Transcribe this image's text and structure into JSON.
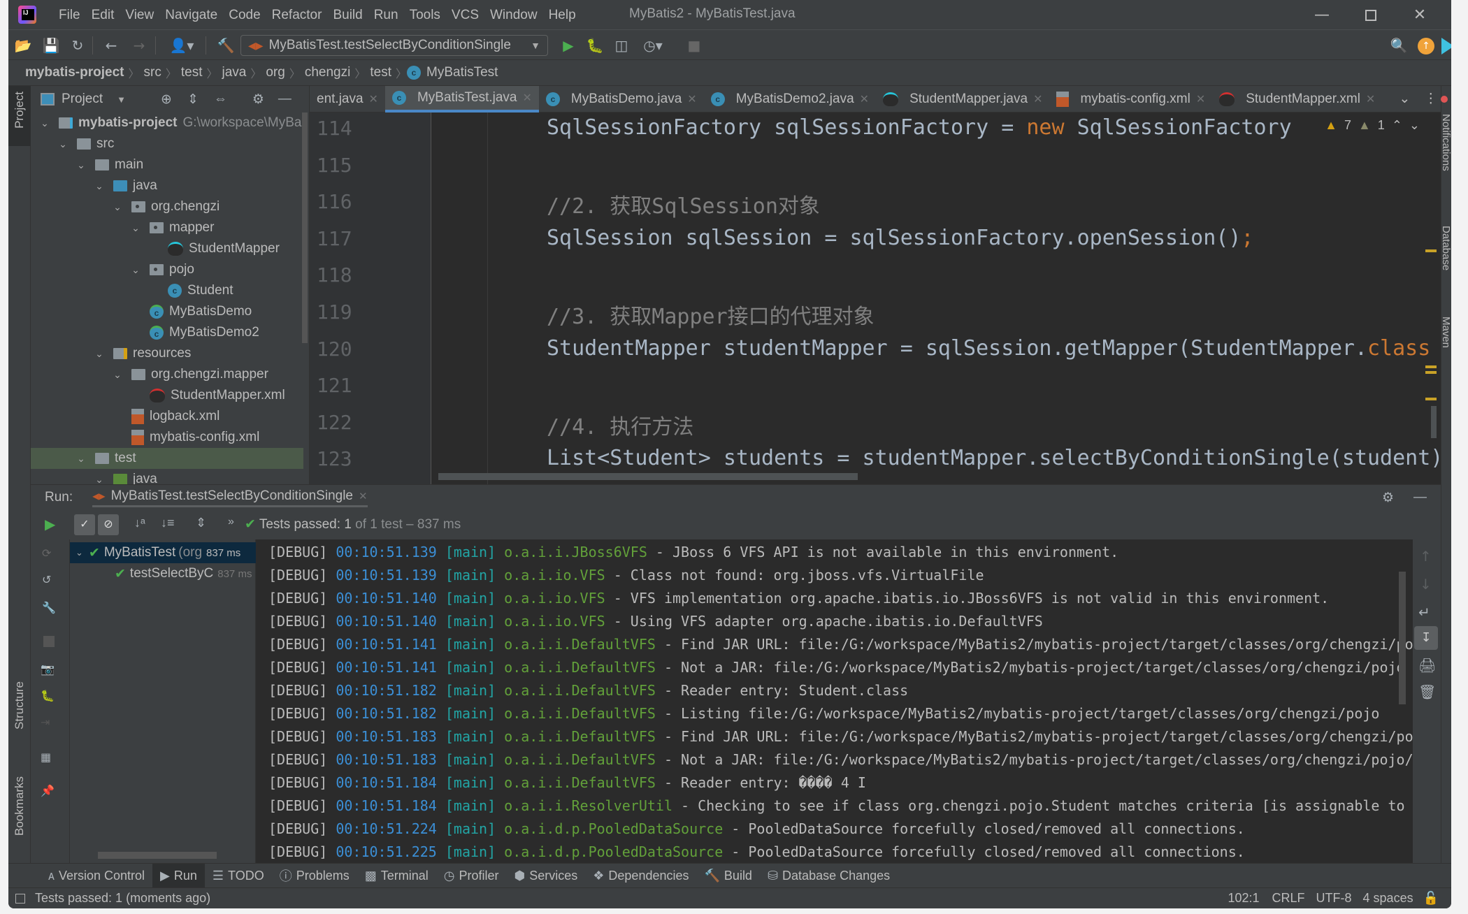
{
  "window": {
    "title": "MyBatis2 - MyBatisTest.java",
    "menu": [
      "File",
      "Edit",
      "View",
      "Navigate",
      "Code",
      "Refactor",
      "Build",
      "Run",
      "Tools",
      "VCS",
      "Window",
      "Help"
    ]
  },
  "toolbar": {
    "run_config": "MyBatisTest.testSelectByConditionSingle"
  },
  "breadcrumb": [
    "mybatis-project",
    "src",
    "test",
    "java",
    "org",
    "chengzi",
    "test",
    "MyBatisTest"
  ],
  "left_stripe": {
    "project": "Project",
    "structure": "Structure",
    "bookmarks": "Bookmarks"
  },
  "project_panel": {
    "title": "Project",
    "tree": [
      {
        "label": "mybatis-project",
        "extra": "G:\\workspace\\MyBa",
        "depth": 0,
        "icon": "module",
        "expanded": true
      },
      {
        "label": "src",
        "depth": 1,
        "icon": "folder",
        "expanded": true
      },
      {
        "label": "main",
        "depth": 2,
        "icon": "folder",
        "expanded": true
      },
      {
        "label": "java",
        "depth": 3,
        "icon": "source-folder",
        "expanded": true
      },
      {
        "label": "org.chengzi",
        "depth": 4,
        "icon": "package",
        "expanded": true
      },
      {
        "label": "mapper",
        "depth": 5,
        "icon": "package",
        "expanded": true
      },
      {
        "label": "StudentMapper",
        "depth": 6,
        "icon": "mybatis-mapper"
      },
      {
        "label": "pojo",
        "depth": 5,
        "icon": "package",
        "expanded": true
      },
      {
        "label": "Student",
        "depth": 6,
        "icon": "class"
      },
      {
        "label": "MyBatisDemo",
        "depth": 5,
        "icon": "class-runnable"
      },
      {
        "label": "MyBatisDemo2",
        "depth": 5,
        "icon": "class-runnable"
      },
      {
        "label": "resources",
        "depth": 3,
        "icon": "resources-folder",
        "expanded": true
      },
      {
        "label": "org.chengzi.mapper",
        "depth": 4,
        "icon": "folder",
        "expanded": true
      },
      {
        "label": "StudentMapper.xml",
        "depth": 5,
        "icon": "mybatis-xml"
      },
      {
        "label": "logback.xml",
        "depth": 4,
        "icon": "xml"
      },
      {
        "label": "mybatis-config.xml",
        "depth": 4,
        "icon": "xml"
      },
      {
        "label": "test",
        "depth": 2,
        "icon": "folder",
        "expanded": true
      },
      {
        "label": "java",
        "depth": 3,
        "icon": "test-folder",
        "expanded": true
      }
    ]
  },
  "editor": {
    "tabs": [
      {
        "label": "ent.java",
        "active": false
      },
      {
        "label": "MyBatisTest.java",
        "active": true
      },
      {
        "label": "MyBatisDemo.java",
        "active": false
      },
      {
        "label": "MyBatisDemo2.java",
        "active": false
      },
      {
        "label": "StudentMapper.java",
        "active": false
      },
      {
        "label": "mybatis-config.xml",
        "active": false
      },
      {
        "label": "StudentMapper.xml",
        "active": false
      }
    ],
    "inspections": {
      "warnings": "7",
      "weak_warnings": "1"
    },
    "lines": [
      {
        "num": "114",
        "parts": [
          {
            "t": "SqlSessionFactory sqlSessionFactory = ",
            "c": ""
          },
          {
            "t": "new",
            "c": "kw"
          },
          {
            "t": " SqlSessionFactory",
            "c": ""
          }
        ]
      },
      {
        "num": "115",
        "parts": []
      },
      {
        "num": "116",
        "parts": [
          {
            "t": "//2. 获取SqlSession对象",
            "c": "cm"
          }
        ]
      },
      {
        "num": "117",
        "parts": [
          {
            "t": "SqlSession sqlSession = sqlSessionFactory.openSession()",
            "c": ""
          },
          {
            "t": ";",
            "c": "kw"
          }
        ]
      },
      {
        "num": "118",
        "parts": []
      },
      {
        "num": "119",
        "parts": [
          {
            "t": "//3. 获取Mapper接口的代理对象",
            "c": "cm"
          }
        ]
      },
      {
        "num": "120",
        "parts": [
          {
            "t": "StudentMapper studentMapper = sqlSession.getMapper(StudentMapper.",
            "c": ""
          },
          {
            "t": "class",
            "c": "kw"
          }
        ]
      },
      {
        "num": "121",
        "parts": []
      },
      {
        "num": "122",
        "parts": [
          {
            "t": "//4. 执行方法",
            "c": "cm"
          }
        ]
      },
      {
        "num": "123",
        "parts": [
          {
            "t": "List<Student> students = studentMapper.selectByConditionSingle(student);",
            "c": ""
          }
        ]
      }
    ]
  },
  "right_stripe": [
    "Notifications",
    "Database",
    "Maven"
  ],
  "run": {
    "label": "Run:",
    "tab": "MyBatisTest.testSelectByConditionSingle",
    "summary_prefix": "Tests passed:",
    "summary_count": "1",
    "summary_suffix": "of 1 test – 837 ms",
    "tests": [
      {
        "label": "MyBatisTest",
        "extra": "(org",
        "time": "837 ms",
        "status": "passed"
      },
      {
        "label": "testSelectByC",
        "time": "837 ms",
        "status": "passed"
      }
    ],
    "log": [
      {
        "level": "[DEBUG]",
        "time": "00:10:51.139",
        "thread": "[main]",
        "logger": "o.a.i.i.JBoss6VFS",
        "msg": " - JBoss 6 VFS API is not available in this environment."
      },
      {
        "level": "[DEBUG]",
        "time": "00:10:51.139",
        "thread": "[main]",
        "logger": "o.a.i.io.VFS",
        "msg": " - Class not found: org.jboss.vfs.VirtualFile"
      },
      {
        "level": "[DEBUG]",
        "time": "00:10:51.140",
        "thread": "[main]",
        "logger": "o.a.i.io.VFS",
        "msg": " - VFS implementation org.apache.ibatis.io.JBoss6VFS is not valid in this environment."
      },
      {
        "level": "[DEBUG]",
        "time": "00:10:51.140",
        "thread": "[main]",
        "logger": "o.a.i.io.VFS",
        "msg": " - Using VFS adapter org.apache.ibatis.io.DefaultVFS"
      },
      {
        "level": "[DEBUG]",
        "time": "00:10:51.141",
        "thread": "[main]",
        "logger": "o.a.i.i.DefaultVFS",
        "msg": " - Find JAR URL: file:/G:/workspace/MyBatis2/mybatis-project/target/classes/org/chengzi/pojo"
      },
      {
        "level": "[DEBUG]",
        "time": "00:10:51.141",
        "thread": "[main]",
        "logger": "o.a.i.i.DefaultVFS",
        "msg": " - Not a JAR: file:/G:/workspace/MyBatis2/mybatis-project/target/classes/org/chengzi/pojo"
      },
      {
        "level": "[DEBUG]",
        "time": "00:10:51.182",
        "thread": "[main]",
        "logger": "o.a.i.i.DefaultVFS",
        "msg": " - Reader entry: Student.class"
      },
      {
        "level": "[DEBUG]",
        "time": "00:10:51.182",
        "thread": "[main]",
        "logger": "o.a.i.i.DefaultVFS",
        "msg": " - Listing file:/G:/workspace/MyBatis2/mybatis-project/target/classes/org/chengzi/pojo"
      },
      {
        "level": "[DEBUG]",
        "time": "00:10:51.183",
        "thread": "[main]",
        "logger": "o.a.i.i.DefaultVFS",
        "msg": " - Find JAR URL: file:/G:/workspace/MyBatis2/mybatis-project/target/classes/org/chengzi/pojo"
      },
      {
        "level": "[DEBUG]",
        "time": "00:10:51.183",
        "thread": "[main]",
        "logger": "o.a.i.i.DefaultVFS",
        "msg": " - Not a JAR: file:/G:/workspace/MyBatis2/mybatis-project/target/classes/org/chengzi/pojo/S"
      },
      {
        "level": "[DEBUG]",
        "time": "00:10:51.184",
        "thread": "[main]",
        "logger": "o.a.i.i.DefaultVFS",
        "msg": " - Reader entry: ����   4 I"
      },
      {
        "level": "[DEBUG]",
        "time": "00:10:51.184",
        "thread": "[main]",
        "logger": "o.a.i.i.ResolverUtil",
        "msg": " - Checking to see if class org.chengzi.pojo.Student matches criteria [is assignable to O"
      },
      {
        "level": "[DEBUG]",
        "time": "00:10:51.224",
        "thread": "[main]",
        "logger": "o.a.i.d.p.PooledDataSource",
        "msg": " - PooledDataSource forcefully closed/removed all connections."
      },
      {
        "level": "[DEBUG]",
        "time": "00:10:51.225",
        "thread": "[main]",
        "logger": "o.a.i.d.p.PooledDataSource",
        "msg": " - PooledDataSource forcefully closed/removed all connections."
      }
    ]
  },
  "bottom_tools": [
    {
      "label": "Version Control",
      "icon": "vcs-icon"
    },
    {
      "label": "Run",
      "icon": "run-icon",
      "active": true
    },
    {
      "label": "TODO",
      "icon": "todo-icon"
    },
    {
      "label": "Problems",
      "icon": "problems-icon"
    },
    {
      "label": "Terminal",
      "icon": "terminal-icon"
    },
    {
      "label": "Profiler",
      "icon": "profiler-icon"
    },
    {
      "label": "Services",
      "icon": "services-icon"
    },
    {
      "label": "Dependencies",
      "icon": "dependencies-icon"
    },
    {
      "label": "Build",
      "icon": "build-icon"
    },
    {
      "label": "Database Changes",
      "icon": "database-changes-icon"
    }
  ],
  "status": {
    "message": "Tests passed: 1 (moments ago)",
    "position": "102:1",
    "line_sep": "CRLF",
    "encoding": "UTF-8",
    "indent": "4 spaces"
  }
}
